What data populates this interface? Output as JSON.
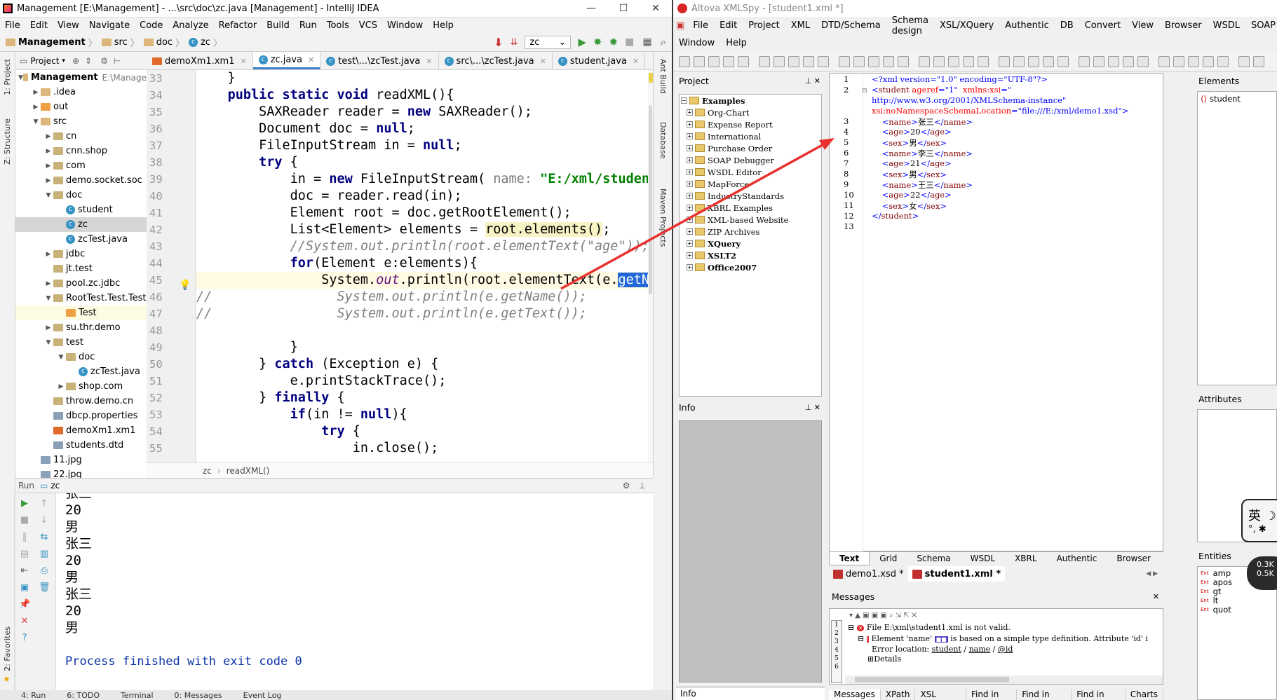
{
  "ij": {
    "title": "Management [E:\\Management] - ...\\src\\doc\\zc.java [Management] - IntelliJ IDEA",
    "menu": [
      "File",
      "Edit",
      "View",
      "Navigate",
      "Code",
      "Analyze",
      "Refactor",
      "Build",
      "Run",
      "Tools",
      "VCS",
      "Window",
      "Help"
    ],
    "nav": [
      "Management",
      "src",
      "doc",
      "zc"
    ],
    "run_config": "zc",
    "project_label": "Project",
    "side_tabs": [
      "1: Project",
      "Z: Structure",
      "2: Favorites"
    ],
    "right_tabs": [
      "Ant Build",
      "Database",
      "Maven Projects"
    ],
    "tree": [
      {
        "label": "Management",
        "hint": "E:\\Manage",
        "depth": 0,
        "arrow": "down",
        "icon": "folder"
      },
      {
        "label": ".idea",
        "depth": 1,
        "arrow": "right",
        "icon": "folder"
      },
      {
        "label": "out",
        "depth": 1,
        "arrow": "right",
        "icon": "folder-orange"
      },
      {
        "label": "src",
        "depth": 1,
        "arrow": "down",
        "icon": "folder"
      },
      {
        "label": "cn",
        "depth": 2,
        "arrow": "right",
        "icon": "package"
      },
      {
        "label": "cnn.shop",
        "depth": 2,
        "arrow": "right",
        "icon": "package"
      },
      {
        "label": "com",
        "depth": 2,
        "arrow": "right",
        "icon": "package"
      },
      {
        "label": "demo.socket.soc",
        "depth": 2,
        "arrow": "right",
        "icon": "package"
      },
      {
        "label": "doc",
        "depth": 2,
        "arrow": "down",
        "icon": "package"
      },
      {
        "label": "student",
        "depth": 3,
        "arrow": "",
        "icon": "class"
      },
      {
        "label": "zc",
        "depth": 3,
        "arrow": "",
        "icon": "class",
        "selected": true
      },
      {
        "label": "zcTest.java",
        "depth": 3,
        "arrow": "",
        "icon": "java"
      },
      {
        "label": "jdbc",
        "depth": 2,
        "arrow": "right",
        "icon": "package"
      },
      {
        "label": "jt.test",
        "depth": 2,
        "arrow": "",
        "icon": "package"
      },
      {
        "label": "pool.zc.jdbc",
        "depth": 2,
        "arrow": "right",
        "icon": "package"
      },
      {
        "label": "RootTest.Test.Test",
        "depth": 2,
        "arrow": "down",
        "icon": "package"
      },
      {
        "label": "Test",
        "depth": 3,
        "arrow": "",
        "icon": "folder-orange",
        "highlight": true
      },
      {
        "label": "su.thr.demo",
        "depth": 2,
        "arrow": "right",
        "icon": "package"
      },
      {
        "label": "test",
        "depth": 2,
        "arrow": "down",
        "icon": "package"
      },
      {
        "label": "doc",
        "depth": 3,
        "arrow": "down",
        "icon": "package"
      },
      {
        "label": "zcTest.java",
        "depth": 4,
        "arrow": "",
        "icon": "java"
      },
      {
        "label": "shop.com",
        "depth": 3,
        "arrow": "right",
        "icon": "package"
      },
      {
        "label": "throw.demo.cn",
        "depth": 2,
        "arrow": "",
        "icon": "package"
      },
      {
        "label": "dbcp.properties",
        "depth": 2,
        "arrow": "",
        "icon": "props"
      },
      {
        "label": "demoXm1.xm1",
        "depth": 2,
        "arrow": "",
        "icon": "xml"
      },
      {
        "label": "students.dtd",
        "depth": 2,
        "arrow": "",
        "icon": "dtd"
      },
      {
        "label": "11.jpg",
        "depth": 1,
        "arrow": "",
        "icon": "image"
      },
      {
        "label": "22.jpg",
        "depth": 1,
        "arrow": "",
        "icon": "image"
      }
    ],
    "tabs": [
      {
        "label": "demoXm1.xm1",
        "active": false
      },
      {
        "label": "zc.java",
        "active": true
      },
      {
        "label": "test\\...\\zcTest.java",
        "active": false
      },
      {
        "label": "src\\...\\zcTest.java",
        "active": false
      },
      {
        "label": "student.java",
        "active": false
      }
    ],
    "line_numbers": [
      "33",
      "34",
      "35",
      "36",
      "37",
      "38",
      "39",
      "40",
      "41",
      "42",
      "43",
      "44",
      "45",
      "46",
      "47",
      "48",
      "49",
      "50",
      "51",
      "52",
      "53",
      "54",
      "55"
    ],
    "breadcrumb": [
      "zc",
      "readXML()"
    ],
    "run_label": "Run",
    "run_name": "zc",
    "console": [
      "张三",
      "20",
      "男",
      "张三",
      "20",
      "男",
      "张三",
      "20",
      "男",
      "",
      "Process finished with exit code 0"
    ],
    "status_tabs": [
      "4: Run",
      "6: TODO",
      "Terminal",
      "0: Messages",
      "Event Log"
    ]
  },
  "xs": {
    "title": "Altova XMLSpy - [student1.xml *]",
    "menu1": [
      "File",
      "Edit",
      "Project",
      "XML",
      "DTD/Schema",
      "Schema design",
      "XSL/XQuery",
      "Authentic",
      "DB",
      "Convert",
      "View",
      "Browser",
      "WSDL",
      "SOAP",
      "XBRL"
    ],
    "menu2": [
      "Window",
      "Help"
    ],
    "project_title": "Project",
    "project_items": [
      {
        "label": "Examples",
        "root": true
      },
      {
        "label": "Org-Chart"
      },
      {
        "label": "Expense Report"
      },
      {
        "label": "International"
      },
      {
        "label": "Purchase Order"
      },
      {
        "label": "SOAP Debugger"
      },
      {
        "label": "WSDL Editor"
      },
      {
        "label": "MapForce"
      },
      {
        "label": "IndustryStandards"
      },
      {
        "label": "XBRL Examples"
      },
      {
        "label": "XML-based Website"
      },
      {
        "label": "ZIP Archives"
      },
      {
        "label": "XQuery",
        "bold": true
      },
      {
        "label": "XSLT2",
        "bold": true
      },
      {
        "label": "Office2007",
        "bold": true
      }
    ],
    "info_title": "Info",
    "info_tab": "Info",
    "xml_line_numbers": [
      "1",
      "2",
      "",
      "",
      "3",
      "4",
      "5",
      "6",
      "7",
      "8",
      "9",
      "10",
      "11",
      "12",
      "13"
    ],
    "view_tabs": [
      "Text",
      "Grid",
      "Schema",
      "WSDL",
      "XBRL",
      "Authentic",
      "Browser"
    ],
    "doc_tabs": [
      {
        "label": "demo1.xsd *",
        "active": false
      },
      {
        "label": "student1.xml *",
        "active": true
      }
    ],
    "messages_title": "Messages",
    "messages": {
      "file": "File E:\\xml\\student1.xml is not valid.",
      "element_pre": "Element 'name'",
      "element_post": "is based on a simple type definition. Attribute 'id' i",
      "err_loc": "Error location:",
      "path": [
        "student",
        "name",
        "@id"
      ],
      "details": "Details"
    },
    "msg_tabs": [
      "Messages",
      "XPath",
      "XSL Outline",
      "Find in Files",
      "Find in Sch...",
      "Find in XBRL",
      "Charts"
    ],
    "elements_title": "Elements",
    "elements": [
      "student"
    ],
    "attributes_title": "Attributes",
    "entities_title": "Entities",
    "entities": [
      "amp",
      "apos",
      "gt",
      "lt",
      "quot"
    ],
    "ime": "英 ☽",
    "ime2": "°, ✱",
    "net": [
      "0.3K",
      "0.5K"
    ]
  }
}
